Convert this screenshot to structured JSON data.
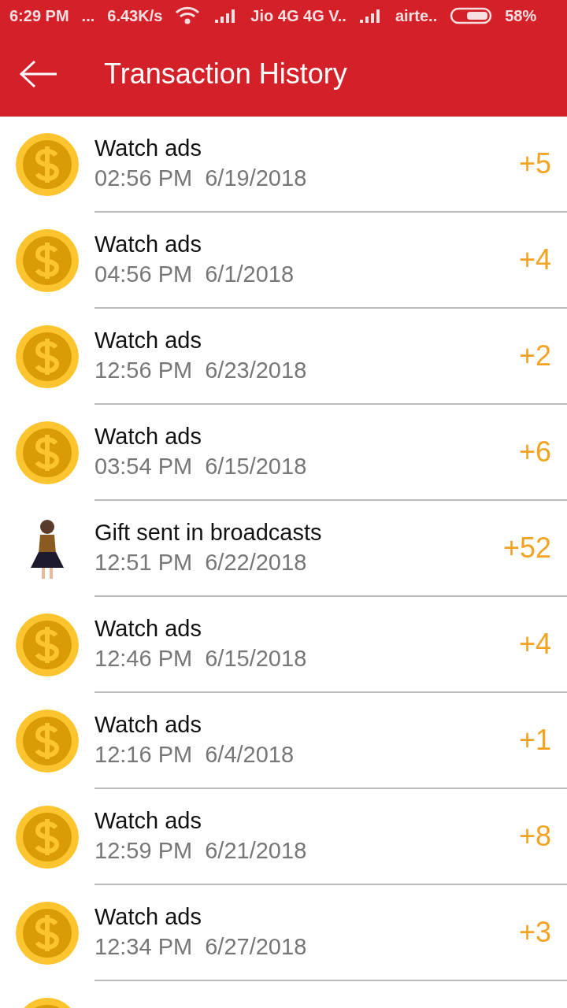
{
  "status_bar": {
    "time": "6:29 PM",
    "dots": "...",
    "speed": "6.43K/s",
    "carrier_1": "Jio 4G 4G V..",
    "carrier_2": "airte..",
    "battery": "58%"
  },
  "app_bar": {
    "title": "Transaction History"
  },
  "transactions": [
    {
      "kind": "coin",
      "title": "Watch ads",
      "time": "02:56 PM  6/19/2018",
      "amount": "+5"
    },
    {
      "kind": "coin",
      "title": "Watch ads",
      "time": "04:56 PM  6/1/2018",
      "amount": "+4"
    },
    {
      "kind": "coin",
      "title": "Watch ads",
      "time": "12:56 PM  6/23/2018",
      "amount": "+2"
    },
    {
      "kind": "coin",
      "title": "Watch ads",
      "time": "03:54 PM  6/15/2018",
      "amount": "+6"
    },
    {
      "kind": "picture",
      "title": "Gift sent in broadcasts",
      "time": "12:51 PM  6/22/2018",
      "amount": "+52"
    },
    {
      "kind": "coin",
      "title": "Watch ads",
      "time": "12:46 PM  6/15/2018",
      "amount": "+4"
    },
    {
      "kind": "coin",
      "title": "Watch ads",
      "time": "12:16 PM  6/4/2018",
      "amount": "+1"
    },
    {
      "kind": "coin",
      "title": "Watch ads",
      "time": "12:59 PM  6/21/2018",
      "amount": "+8"
    },
    {
      "kind": "coin",
      "title": "Watch ads",
      "time": "12:34 PM  6/27/2018",
      "amount": "+3"
    },
    {
      "kind": "coin"
    }
  ]
}
